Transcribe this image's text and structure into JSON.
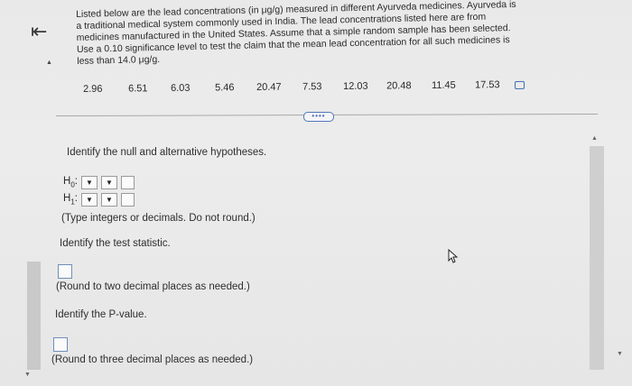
{
  "problem": {
    "lines": [
      "Listed below are the lead concentrations (in μg/g) measured in different Ayurveda medicines. Ayurveda is",
      "a traditional medical system commonly used in India. The lead concentrations listed here are from",
      "medicines manufactured in the United States. Assume that a simple random sample has been selected.",
      "Use a 0.10 significance level to test the claim that the mean lead concentration for all such medicines is",
      "less than 14.0 μg/g."
    ]
  },
  "data_values": [
    "2.96",
    "6.51",
    "6.03",
    "5.46",
    "20.47",
    "7.53",
    "12.03",
    "20.48",
    "11.45",
    "17.53"
  ],
  "more_button": "••••",
  "hypotheses": {
    "prompt": "Identify the null and alternative hypotheses.",
    "h0_label": "H",
    "h0_sub": "0",
    "h1_label": "H",
    "h1_sub": "1",
    "dropdown_glyph": "▼",
    "hint": "(Type integers or decimals. Do not round.)"
  },
  "test_statistic": {
    "prompt": "Identify the test statistic.",
    "hint": "(Round to two decimal places as needed.)"
  },
  "p_value": {
    "prompt": "Identify the P-value.",
    "hint": "(Round to three decimal places as needed.)"
  },
  "icons": {
    "back": "back-arrow-icon",
    "copy": "copy-icon",
    "cursor": "mouse-cursor-icon"
  }
}
